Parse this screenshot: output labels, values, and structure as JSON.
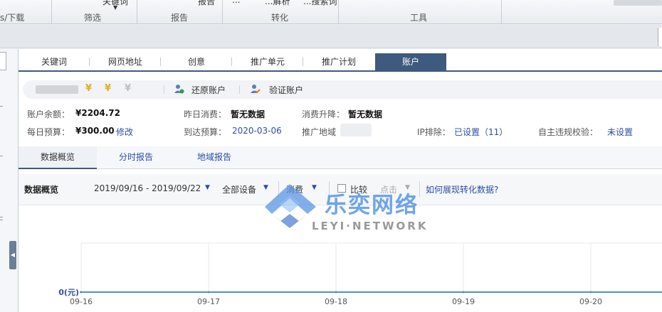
{
  "ribbon": {
    "download_label": "s/下载",
    "filter_label": "筛选",
    "report_label": "报告",
    "convert_label": "转化",
    "tools_label": "工具",
    "top_item_keyword": "关键词",
    "top_item_report": "报告",
    "top_item_convert": "...",
    "top_item_analyze": "...解析",
    "top_item_search": "...搜索词"
  },
  "tabs": [
    {
      "label": "关键词"
    },
    {
      "label": "网页地址"
    },
    {
      "label": "创意"
    },
    {
      "label": "推广单元"
    },
    {
      "label": "推广计划"
    },
    {
      "label": "账户"
    }
  ],
  "account": {
    "restore_label": "还原账户",
    "verify_label": "验证账户",
    "yen_glyph": "¥"
  },
  "info": {
    "balance_label": "账户余额：",
    "balance_value": "¥2204.72",
    "yesterday_label": "昨日消费：",
    "yesterday_value": "暂无数据",
    "trend_label": "消费升降：",
    "trend_value": "暂无数据",
    "daily_budget_label": "每日预算：",
    "daily_budget_value": "¥300.00",
    "modify_label": "修改",
    "reach_budget_label": "到达预算：",
    "reach_budget_value": "2020-03-06",
    "region_label": "推广地域",
    "ip_label": "IP排除：",
    "ip_value": "已设置（11）",
    "check_label": "自主违规校验：",
    "check_value": "未设置"
  },
  "subtabs": [
    {
      "label": "数据概览"
    },
    {
      "label": "分时报告"
    },
    {
      "label": "地域报告"
    }
  ],
  "filter": {
    "title": "数据概览",
    "date_range": "2019/09/16 - 2019/09/22",
    "device": "全部设备",
    "metric": "消费",
    "compare_label": "比较",
    "click_label": "点击",
    "help_link": "如何展现转化数据?"
  },
  "watermark": {
    "cn": "乐奕网络",
    "en": "LEYI·NETWORK"
  },
  "chart_data": {
    "type": "line",
    "x": [
      "09-16",
      "09-17",
      "09-18",
      "09-19",
      "09-20"
    ],
    "series": [
      {
        "values": [
          0,
          0,
          0,
          0,
          0
        ]
      }
    ],
    "y_tick_label": "0(元)",
    "color": "#4a90d9"
  }
}
